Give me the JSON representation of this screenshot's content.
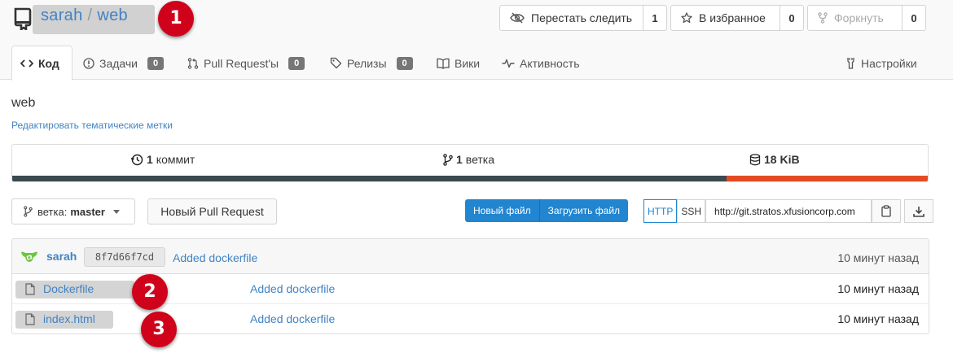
{
  "repo": {
    "owner": "sarah",
    "separator": "/",
    "name": "web",
    "description_name": "web",
    "topics_link": "Редактировать тематические метки"
  },
  "header_buttons": {
    "watch": {
      "label": "Перестать следить",
      "count": "1",
      "icon": "eye-slash-icon"
    },
    "star": {
      "label": "В избранное",
      "count": "0",
      "icon": "star-icon"
    },
    "fork": {
      "label": "Форкнуть",
      "count": "0",
      "icon": "fork-icon"
    }
  },
  "tabs": [
    {
      "label": "Код",
      "icon": "code-icon",
      "active": true
    },
    {
      "label": "Задачи",
      "badge": "0",
      "icon": "issue-icon"
    },
    {
      "label": "Pull Request'ы",
      "badge": "0",
      "icon": "pull-request-icon"
    },
    {
      "label": "Релизы",
      "badge": "0",
      "icon": "tag-icon"
    },
    {
      "label": "Вики",
      "icon": "book-icon"
    },
    {
      "label": "Активность",
      "icon": "pulse-icon"
    },
    {
      "label": "Настройки",
      "icon": "tools-icon"
    }
  ],
  "stats": {
    "commits_count": "1",
    "commits_label": "коммит",
    "branches_count": "1",
    "branches_label": "ветка",
    "size": "18 KiB"
  },
  "language_bar": {
    "segments": [
      {
        "color": "#3a4a4f",
        "fraction": 0.78
      },
      {
        "color": "#e44b23",
        "fraction": 0.22
      }
    ]
  },
  "toolbar": {
    "branch_prefix": "ветка:",
    "branch_name": "master",
    "new_pr": "Новый Pull Request",
    "new_file": "Новый файл",
    "upload_file": "Загрузить файл",
    "http": "HTTP",
    "ssh": "SSH",
    "clone_url": "http://git.stratos.xfusioncorp.com"
  },
  "latest_commit": {
    "author": "sarah",
    "sha": "8f7d66f7cd",
    "message": "Added dockerfile",
    "time": "10 минут назад"
  },
  "files": [
    {
      "name": "Dockerfile",
      "message": "Added dockerfile",
      "time": "10 минут назад"
    },
    {
      "name": "index.html",
      "message": "Added dockerfile",
      "time": "10 минут назад"
    }
  ],
  "markers": [
    "1",
    "2",
    "3"
  ],
  "colors": {
    "accent": "#2185d0",
    "link": "#4183c4",
    "marker": "#d0021b"
  }
}
